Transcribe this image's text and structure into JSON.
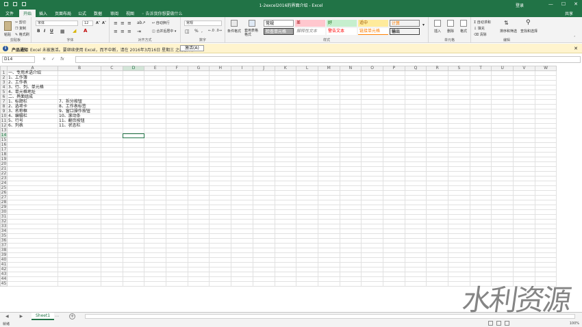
{
  "window": {
    "title": "1-2excel2016的界面介绍 - Excel",
    "login": "登录",
    "controls": [
      "—",
      "☐",
      "✕"
    ]
  },
  "tabs": [
    "文件",
    "开始",
    "插入",
    "页面布局",
    "公式",
    "数据",
    "审阅",
    "视图"
  ],
  "active_tab": "开始",
  "tellme": "告诉我你想要做什么",
  "share_label": "共享",
  "ribbon": {
    "groups": [
      "剪贴板",
      "字体",
      "对齐方式",
      "数字",
      "样式",
      "单元格",
      "编辑"
    ],
    "clipboard": {
      "paste": "粘贴",
      "cut": "剪切",
      "copy": "复制",
      "format_painter": "格式刷"
    },
    "font": {
      "name": "宋体",
      "size": "12",
      "bold": "B",
      "italic": "I",
      "underline": "U",
      "grow": "A˄",
      "shrink": "A˅"
    },
    "alignment": {
      "wrap": "自动换行",
      "merge": "合并后居中"
    },
    "number": {
      "format": "常规",
      "percent": "%",
      "comma": ","
    },
    "styles": {
      "conditional": "条件格式",
      "table": "套用表格格式",
      "cells": [
        {
          "label": "常规",
          "bg": "#ffffff",
          "fg": "#000000"
        },
        {
          "label": "差",
          "bg": "#ffc7ce",
          "fg": "#9c0006"
        },
        {
          "label": "好",
          "bg": "#c6efce",
          "fg": "#006100"
        },
        {
          "label": "适中",
          "bg": "#ffeb9c",
          "fg": "#9c5700"
        },
        {
          "label": "计算",
          "bg": "#f2f2f2",
          "fg": "#fa7d00"
        },
        {
          "label": "检查单元格",
          "bg": "#a5a5a5",
          "fg": "#ffffff"
        },
        {
          "label": "解释性文本",
          "bg": "#ffffff",
          "fg": "#7f7f7f"
        },
        {
          "label": "警告文本",
          "bg": "#ffffff",
          "fg": "#ff0000"
        },
        {
          "label": "链接单元格",
          "bg": "#ffffff",
          "fg": "#fa7d00"
        },
        {
          "label": "输出",
          "bg": "#f2f2f2",
          "fg": "#3f3f3f"
        }
      ]
    },
    "cells": {
      "insert": "插入",
      "delete": "删除",
      "format": "格式"
    },
    "editing": {
      "autosum": "自动求和",
      "fill": "填充",
      "clear": "清除",
      "sort": "排序和筛选",
      "find": "查找和选择"
    }
  },
  "notification": {
    "title": "产品通知",
    "message": "Excel 未被激活。要继续使用 Excel，而不中断，请在 2016年3月16日 星期三 之前激活。",
    "action": "激活(A)",
    "close": "✕"
  },
  "formula_bar": {
    "name_box": "D14",
    "fx": "fx",
    "cancel": "✕",
    "enter": "✓",
    "value": ""
  },
  "columns": [
    "A",
    "B",
    "C",
    "D",
    "E",
    "F",
    "G",
    "H",
    "I",
    "J",
    "K",
    "L",
    "M",
    "N",
    "O",
    "P",
    "Q",
    "R",
    "S",
    "T",
    "U",
    "V",
    "W"
  ],
  "selected": {
    "row": 14,
    "col": "D"
  },
  "cells": {
    "A1": "一、专用术语介绍",
    "A2": "1、工作簿",
    "A3": "2、工作表",
    "A4": "3、行、列、单元格",
    "A5": "4、单元格地址",
    "A6": "二、界面组成",
    "A7": "1、标题栏",
    "A8": "2、选项卡",
    "A9": "3、名称框",
    "A10": "4、编辑栏",
    "A11": "5、行号",
    "A12": "6、列表",
    "B7": "7、拆分按钮",
    "B8": "8、工作表标签",
    "B9": "9、窗口操作按钮",
    "B10": "10、滚动条",
    "B11": "11、翻页按钮",
    "B12": "11、状态栏"
  },
  "row_count": 45,
  "sheets": [
    "Sheet1"
  ],
  "sheet_extra": [
    "⋯"
  ],
  "status": {
    "ready": "就绪",
    "zoom": "100%"
  },
  "watermark": "水利资源"
}
